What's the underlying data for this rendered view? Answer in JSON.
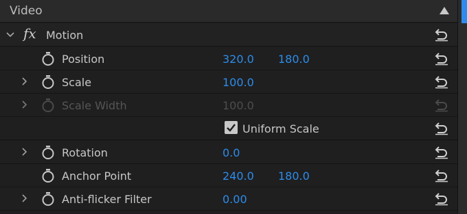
{
  "header": {
    "title": "Video"
  },
  "motion": {
    "fx": "fx",
    "label": "Motion"
  },
  "properties": [
    {
      "label": "Position",
      "value1": "320.0",
      "value2": "180.0"
    },
    {
      "label": "Scale",
      "value1": "100.0"
    },
    {
      "label": "Scale Width",
      "value1": "100.0",
      "disabled": true
    },
    {
      "checkbox_label": "Uniform Scale",
      "checked": true
    },
    {
      "label": "Rotation",
      "value1": "0.0"
    },
    {
      "label": "Anchor Point",
      "value1": "240.0",
      "value2": "180.0"
    },
    {
      "label": "Anti-flicker Filter",
      "value1": "0.00"
    }
  ],
  "colors": {
    "value": "#2d8ceb",
    "disabled": "#555555",
    "text": "#c8c8c8"
  }
}
